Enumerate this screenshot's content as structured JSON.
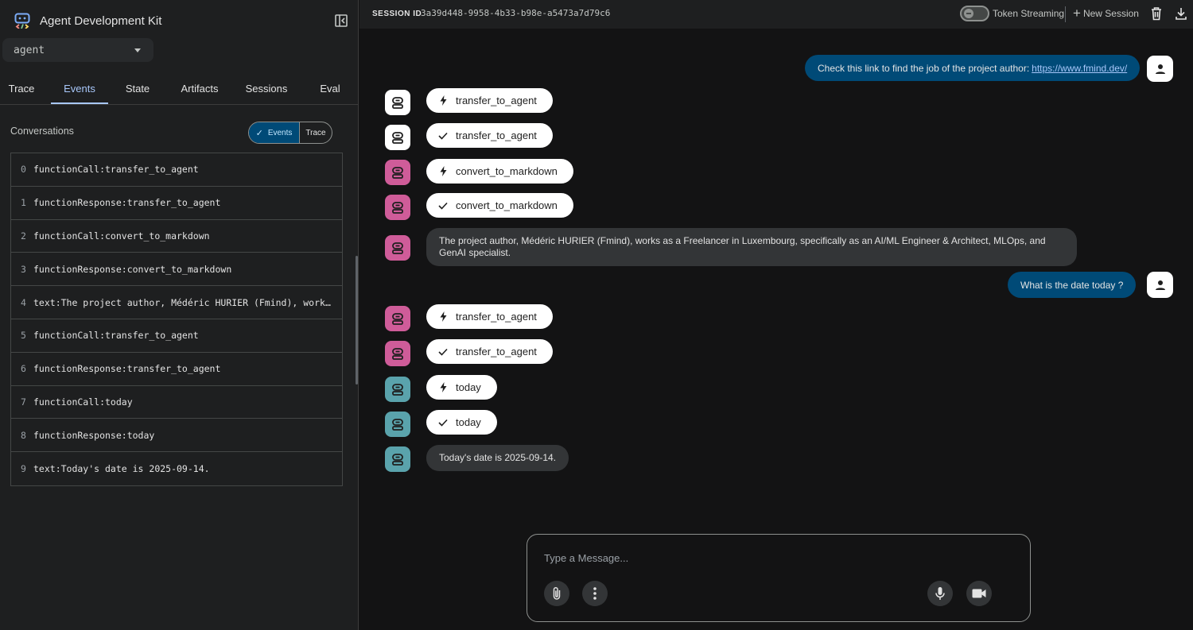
{
  "app": {
    "title": "Agent Development Kit"
  },
  "agent_select": {
    "value": "agent"
  },
  "tabs": [
    "Trace",
    "Events",
    "State",
    "Artifacts",
    "Sessions",
    "Eval"
  ],
  "active_tab": "Events",
  "conversations": {
    "label": "Conversations",
    "toggle_on": "Events",
    "toggle_off": "Trace",
    "events": [
      {
        "index": "0",
        "text": "functionCall:transfer_to_agent"
      },
      {
        "index": "1",
        "text": "functionResponse:transfer_to_agent"
      },
      {
        "index": "2",
        "text": "functionCall:convert_to_markdown"
      },
      {
        "index": "3",
        "text": "functionResponse:convert_to_markdown"
      },
      {
        "index": "4",
        "text": "text:The project author, Médéric HURIER (Fmind), works as a Freelancer in Luxembourg, specifically as an AI/ML Engineer & Architect, MLOps, and GenAI specialist."
      },
      {
        "index": "5",
        "text": "functionCall:transfer_to_agent"
      },
      {
        "index": "6",
        "text": "functionResponse:transfer_to_agent"
      },
      {
        "index": "7",
        "text": "functionCall:today"
      },
      {
        "index": "8",
        "text": "functionResponse:today"
      },
      {
        "index": "9",
        "text": "text:Today's date is 2025-09-14."
      }
    ]
  },
  "topbar": {
    "session_label": "SESSION ID",
    "session_id": "3a39d448-9958-4b33-b98e-a5473a7d79c6",
    "token_streaming": "Token Streaming",
    "token_streaming_enabled": false,
    "new_session": "New Session"
  },
  "chat": {
    "user_message_1": {
      "text": "Check this link to find the job of the project author:",
      "link": "https://www.fmind.dev/"
    },
    "chips": [
      {
        "kind": "call",
        "label": "transfer_to_agent",
        "agent": "white"
      },
      {
        "kind": "response",
        "label": "transfer_to_agent",
        "agent": "white"
      },
      {
        "kind": "call",
        "label": "convert_to_markdown",
        "agent": "pink"
      },
      {
        "kind": "response",
        "label": "convert_to_markdown",
        "agent": "pink"
      },
      {
        "kind": "call",
        "label": "transfer_to_agent",
        "agent": "pink"
      },
      {
        "kind": "response",
        "label": "transfer_to_agent",
        "agent": "pink"
      },
      {
        "kind": "call",
        "label": "today",
        "agent": "teal"
      },
      {
        "kind": "response",
        "label": "today",
        "agent": "teal"
      }
    ],
    "bot_message_1": "The project author, Médéric HURIER (Fmind), works as a Freelancer in Luxembourg, specifically as an AI/ML Engineer & Architect, MLOps, and GenAI specialist.",
    "user_message_2": "What is the date today ?",
    "bot_message_2": "Today's date is 2025-09-14."
  },
  "composer": {
    "placeholder": "Type a Message..."
  },
  "colors": {
    "accent": "#a8c7fa",
    "user_bubble": "#004a77",
    "agent_white": "#ffffff",
    "agent_pink": "#cf5c99",
    "agent_teal": "#5aa3ac"
  }
}
